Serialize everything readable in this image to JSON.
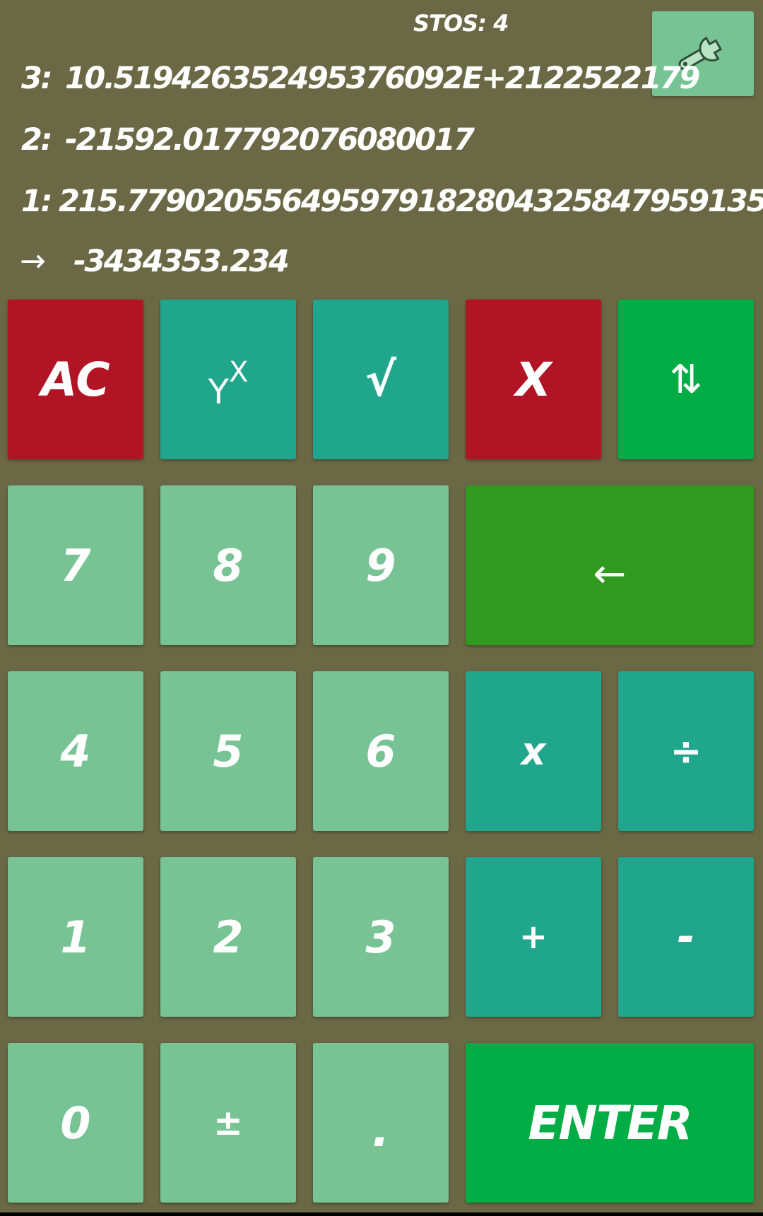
{
  "stack": {
    "stos_label": "STOS:",
    "stos_count": "4",
    "rows": [
      {
        "label": "3:",
        "value": "10.519426352495376092E+2122522179"
      },
      {
        "label": "2:",
        "value": "-21592.017792076080017"
      },
      {
        "label": "1:",
        "value": "215.779020556495979182804325847959135"
      }
    ],
    "input_arrow": "→",
    "input_value": "-3434353.234"
  },
  "keys": {
    "ac": "AC",
    "pow_base": "Y",
    "pow_exp": "X",
    "sqrt": "√",
    "drop": "X",
    "swap": "⇅",
    "k7": "7",
    "k8": "8",
    "k9": "9",
    "backspace": "←",
    "k4": "4",
    "k5": "5",
    "k6": "6",
    "mul": "x",
    "div": "÷",
    "k1": "1",
    "k2": "2",
    "k3": "3",
    "add": "+",
    "sub": "-",
    "k0": "0",
    "negate": "±",
    "dot": ".",
    "enter": "ENTER"
  },
  "icons": {
    "settings": "wrench-icon"
  },
  "colors": {
    "background": "#6a6845",
    "red": "#b11424",
    "teal": "#20a68c",
    "light_green": "#77c394",
    "bright_green": "#00ad45",
    "dark_green": "#2f9a1e"
  }
}
